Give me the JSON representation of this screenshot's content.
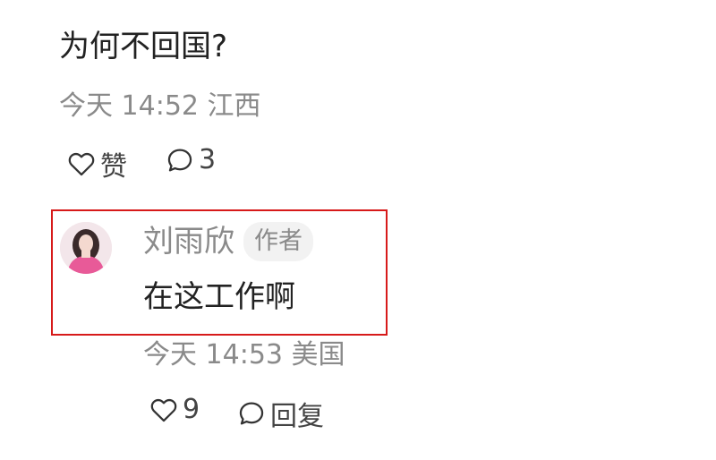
{
  "comment": {
    "text": "为何不回国?",
    "meta": "今天 14:52 江西",
    "like_label": "赞",
    "comment_count": "3"
  },
  "reply": {
    "author_name": "刘雨欣",
    "author_badge": "作者",
    "text": "在这工作啊",
    "meta": "今天 14:53 美国",
    "like_count": "9",
    "reply_label": "回复"
  },
  "colors": {
    "highlight_border": "#d71a1a",
    "secondary_text": "#8a8a8a",
    "primary_text": "#222222"
  }
}
